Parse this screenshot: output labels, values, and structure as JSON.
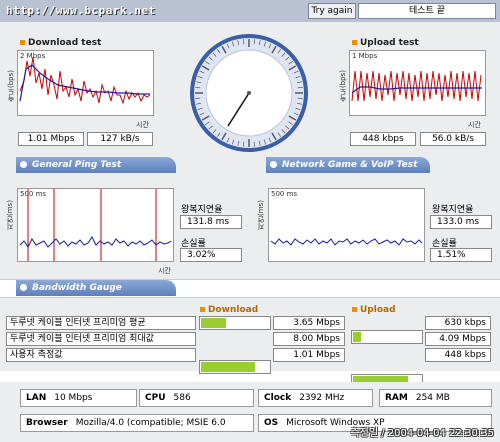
{
  "header": {
    "url": "http://www.bcpark.net",
    "try_again": "Try again",
    "status": "테스트 끝"
  },
  "download": {
    "title": "Download test",
    "scale": "2 Mbps",
    "axis_y": "속도(bps)",
    "axis_x": "시간",
    "speed": "1.01 Mbps",
    "rate": "127 kB/s"
  },
  "upload": {
    "title": "Upload test",
    "scale": "1 Mbps",
    "axis_y": "속도(bps)",
    "axis_x": "시간",
    "speed": "448 kbps",
    "rate": "56.0 kB/s"
  },
  "tabs": {
    "ping": "General Ping Test",
    "game": "Network Game & VoIP Test",
    "bandwidth": "Bandwidth Gauge"
  },
  "ping_left": {
    "scale": "500 ms",
    "axis_y": "지연(ms)",
    "axis_x": "시간",
    "latency_label": "왕복지연율",
    "latency": "131.8 ms",
    "loss_label": "손실률",
    "loss": "3.02%"
  },
  "ping_right": {
    "scale": "500 ms",
    "axis_y": "지연(ms)",
    "axis_x": "시간",
    "latency_label": "왕복지연율",
    "latency": "133.0 ms",
    "loss_label": "손실률",
    "loss": "1.51%"
  },
  "bandwidth": {
    "download_label": "Download",
    "upload_label": "Upload",
    "rows": [
      {
        "name": "두루넷 케이블 인터넷 프리미엄 평균",
        "down": "3.65 Mbps",
        "down_fill": 0.35,
        "up": "630 kbps",
        "up_fill": 0.12
      },
      {
        "name": "두루넷 케이블 인터넷 프리미엄 최대값",
        "down": "8.00 Mbps",
        "down_fill": 0.77,
        "up": "4.09 Mbps",
        "up_fill": 0.78
      },
      {
        "name": "사용자 측정값",
        "down": "1.01 Mbps",
        "down_fill": 0.1,
        "up": "448 kbps",
        "up_fill": 0.09
      }
    ]
  },
  "system": {
    "lan_label": "LAN",
    "lan": "10 Mbps",
    "cpu_label": "CPU",
    "cpu": "586",
    "clock_label": "Clock",
    "clock": "2392 MHz",
    "ram_label": "RAM",
    "ram": "254 MB",
    "browser_label": "Browser",
    "browser": "Mozilla/4.0 (compatible; MSIE 6.0",
    "os_label": "OS",
    "os": "Microsoft Windows XP"
  },
  "footer": "측정일 / 2004-04-04 22:30:35",
  "colors": {
    "header_bg": "#b8c2d3",
    "tab_blue": "#5c7fbd",
    "accent_orange": "#f28b00",
    "bar_green": "#9acd32",
    "trace_red": "#cc0000",
    "trace_blue": "#1a1aa0"
  }
}
